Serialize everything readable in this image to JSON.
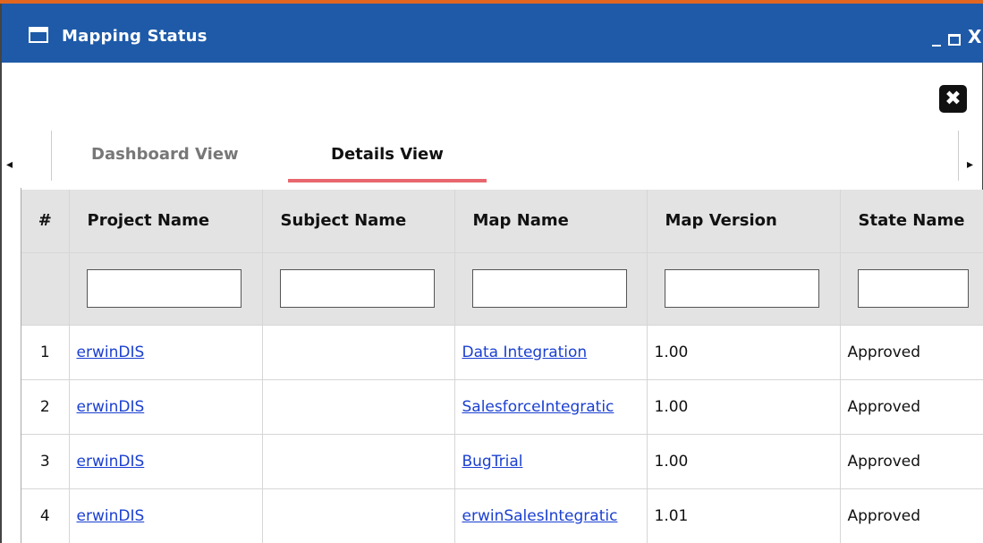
{
  "window": {
    "title": "Mapping Status",
    "controls": {
      "minimize": "_",
      "close": "X"
    },
    "panel_close": "✖"
  },
  "tabs": [
    {
      "label": "Dashboard View",
      "active": false
    },
    {
      "label": "Details View",
      "active": true
    }
  ],
  "tab_nav": {
    "prev": "◂",
    "next": "▸"
  },
  "grid": {
    "columns": [
      "#",
      "Project Name",
      "Subject Name",
      "Map Name",
      "Map Version",
      "State Name"
    ],
    "filters": [
      "",
      "",
      "",
      "",
      ""
    ],
    "rows": [
      {
        "num": "1",
        "project": "erwinDIS",
        "subject": "",
        "map": "Data Integration",
        "version": "1.00",
        "state": "Approved"
      },
      {
        "num": "2",
        "project": "erwinDIS",
        "subject": "",
        "map": "SalesforceIntegratic",
        "version": "1.00",
        "state": "Approved"
      },
      {
        "num": "3",
        "project": "erwinDIS",
        "subject": "",
        "map": "BugTrial",
        "version": "1.00",
        "state": "Approved"
      },
      {
        "num": "4",
        "project": "erwinDIS",
        "subject": "",
        "map": "erwinSalesIntegratic",
        "version": "1.01",
        "state": "Approved"
      }
    ]
  },
  "colors": {
    "accent": "#e3661f",
    "titlebar": "#1e5aa8",
    "tab_underline": "#e8676f",
    "link": "#1a3fd1",
    "header_bg": "#e3e3e3"
  }
}
